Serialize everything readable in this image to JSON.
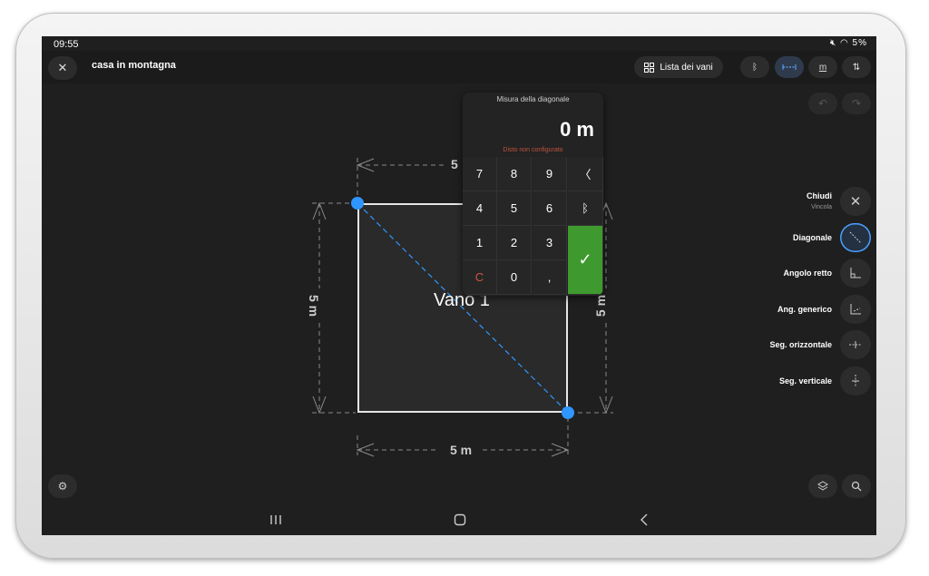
{
  "status": {
    "time": "09:55",
    "battery": "5%"
  },
  "header": {
    "title": "casa in montagna",
    "room_list_label": "Lista dei vani",
    "unit_label": "m"
  },
  "room": {
    "label": "Vano 1"
  },
  "dimensions": {
    "top": "5",
    "bottom": "5 m",
    "left": "5 m",
    "right": "5 m"
  },
  "keypad": {
    "title": "Misura della diagonale",
    "value": "0 m",
    "warning": "Disto non configurato",
    "keys": {
      "k7": "7",
      "k8": "8",
      "k9": "9",
      "k4": "4",
      "k5": "5",
      "k6": "6",
      "k1": "1",
      "k2": "2",
      "k3": "3",
      "kc": "C",
      "k0": "0",
      "kcomma": ","
    },
    "confirm": "✓"
  },
  "side_menu": {
    "close": "Chiudi",
    "close_sub": "Vincola",
    "diagonal": "Diagonale",
    "right_angle": "Angolo retto",
    "generic_angle": "Ang. generico",
    "horizontal_segment": "Seg. orizzontale",
    "vertical_segment": "Seg. verticale"
  },
  "colors": {
    "accent": "#2f96ff",
    "confirm": "#3e9a2e",
    "warning": "#c0533e",
    "background": "#1f1f1f"
  },
  "icons": [
    "close-icon",
    "grid-icon",
    "bluetooth-icon",
    "measure-icon",
    "unit-icon",
    "sort-icon",
    "undo-icon",
    "redo-icon",
    "backspace-icon",
    "check-icon",
    "diagonal-icon",
    "right-angle-icon",
    "generic-angle-icon",
    "horizontal-segment-icon",
    "vertical-segment-icon",
    "settings-icon",
    "layers-icon",
    "search-icon"
  ]
}
